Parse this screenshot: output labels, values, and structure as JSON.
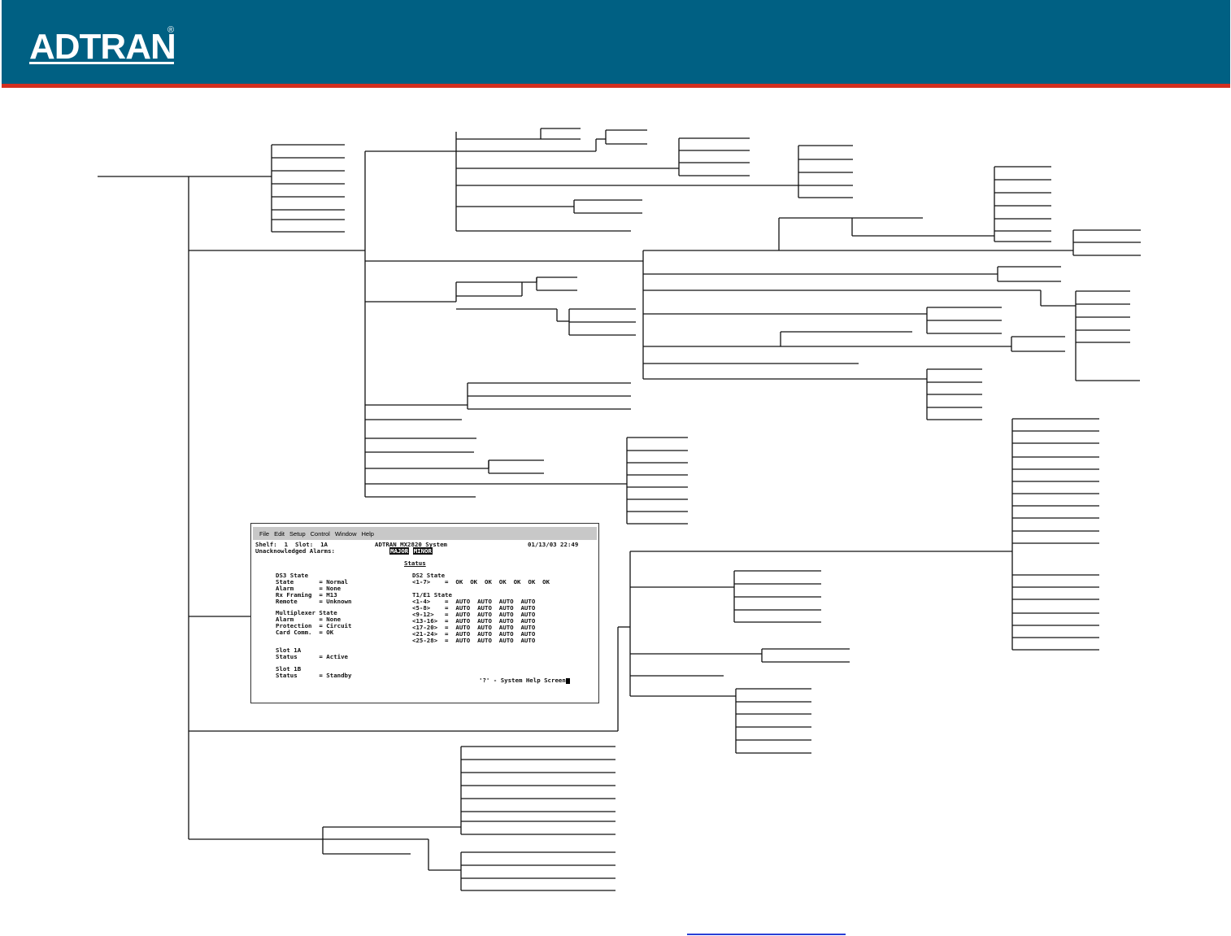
{
  "header": {
    "logo_text": "ADTRAN",
    "registered_mark": "®",
    "colors": {
      "banner": "#006083",
      "accent_stripe": "#d32f1f"
    }
  },
  "terminal": {
    "menu": [
      "File",
      "Edit",
      "Setup",
      "Control",
      "Window",
      "Help"
    ],
    "shelf_line": "Shelf:  1  Slot:  1A",
    "system_name": "ADTRAN MX2820 System",
    "datetime": "01/13/03 22:49",
    "alarms_label": "Unacknowledged Alarms:",
    "alarm_major": "MAJOR",
    "alarm_minor": "MINOR",
    "status_title": "Status",
    "ds3": {
      "heading": "DS3 State",
      "rows": [
        "State       = Normal",
        "Alarm       = None",
        "Rx Framing  = M13",
        "Remote      = Unknown"
      ]
    },
    "mux": {
      "heading": "Multiplexer State",
      "rows": [
        "Alarm       = None",
        "Protection  = Circuit",
        "Card Comm.  = OK"
      ]
    },
    "slot1a": {
      "heading": "Slot 1A",
      "row": "Status      = Active"
    },
    "slot1b": {
      "heading": "Slot 1B",
      "row": "Status      = Standby"
    },
    "ds2": {
      "heading": "DS2 State",
      "row": "<1-7>    =  OK  OK  OK  OK  OK  OK  OK"
    },
    "t1e1": {
      "heading": "T1/E1 State",
      "rows": [
        "<1-4>    =  AUTO  AUTO  AUTO  AUTO",
        "<5-8>    =  AUTO  AUTO  AUTO  AUTO",
        "<9-12>   =  AUTO  AUTO  AUTO  AUTO",
        "<13-16>  =  AUTO  AUTO  AUTO  AUTO",
        "<17-20>  =  AUTO  AUTO  AUTO  AUTO",
        "<21-24>  =  AUTO  AUTO  AUTO  AUTO",
        "<25-28>  =  AUTO  AUTO  AUTO  AUTO"
      ]
    },
    "help_hint": "'?' - System Help Screen"
  }
}
